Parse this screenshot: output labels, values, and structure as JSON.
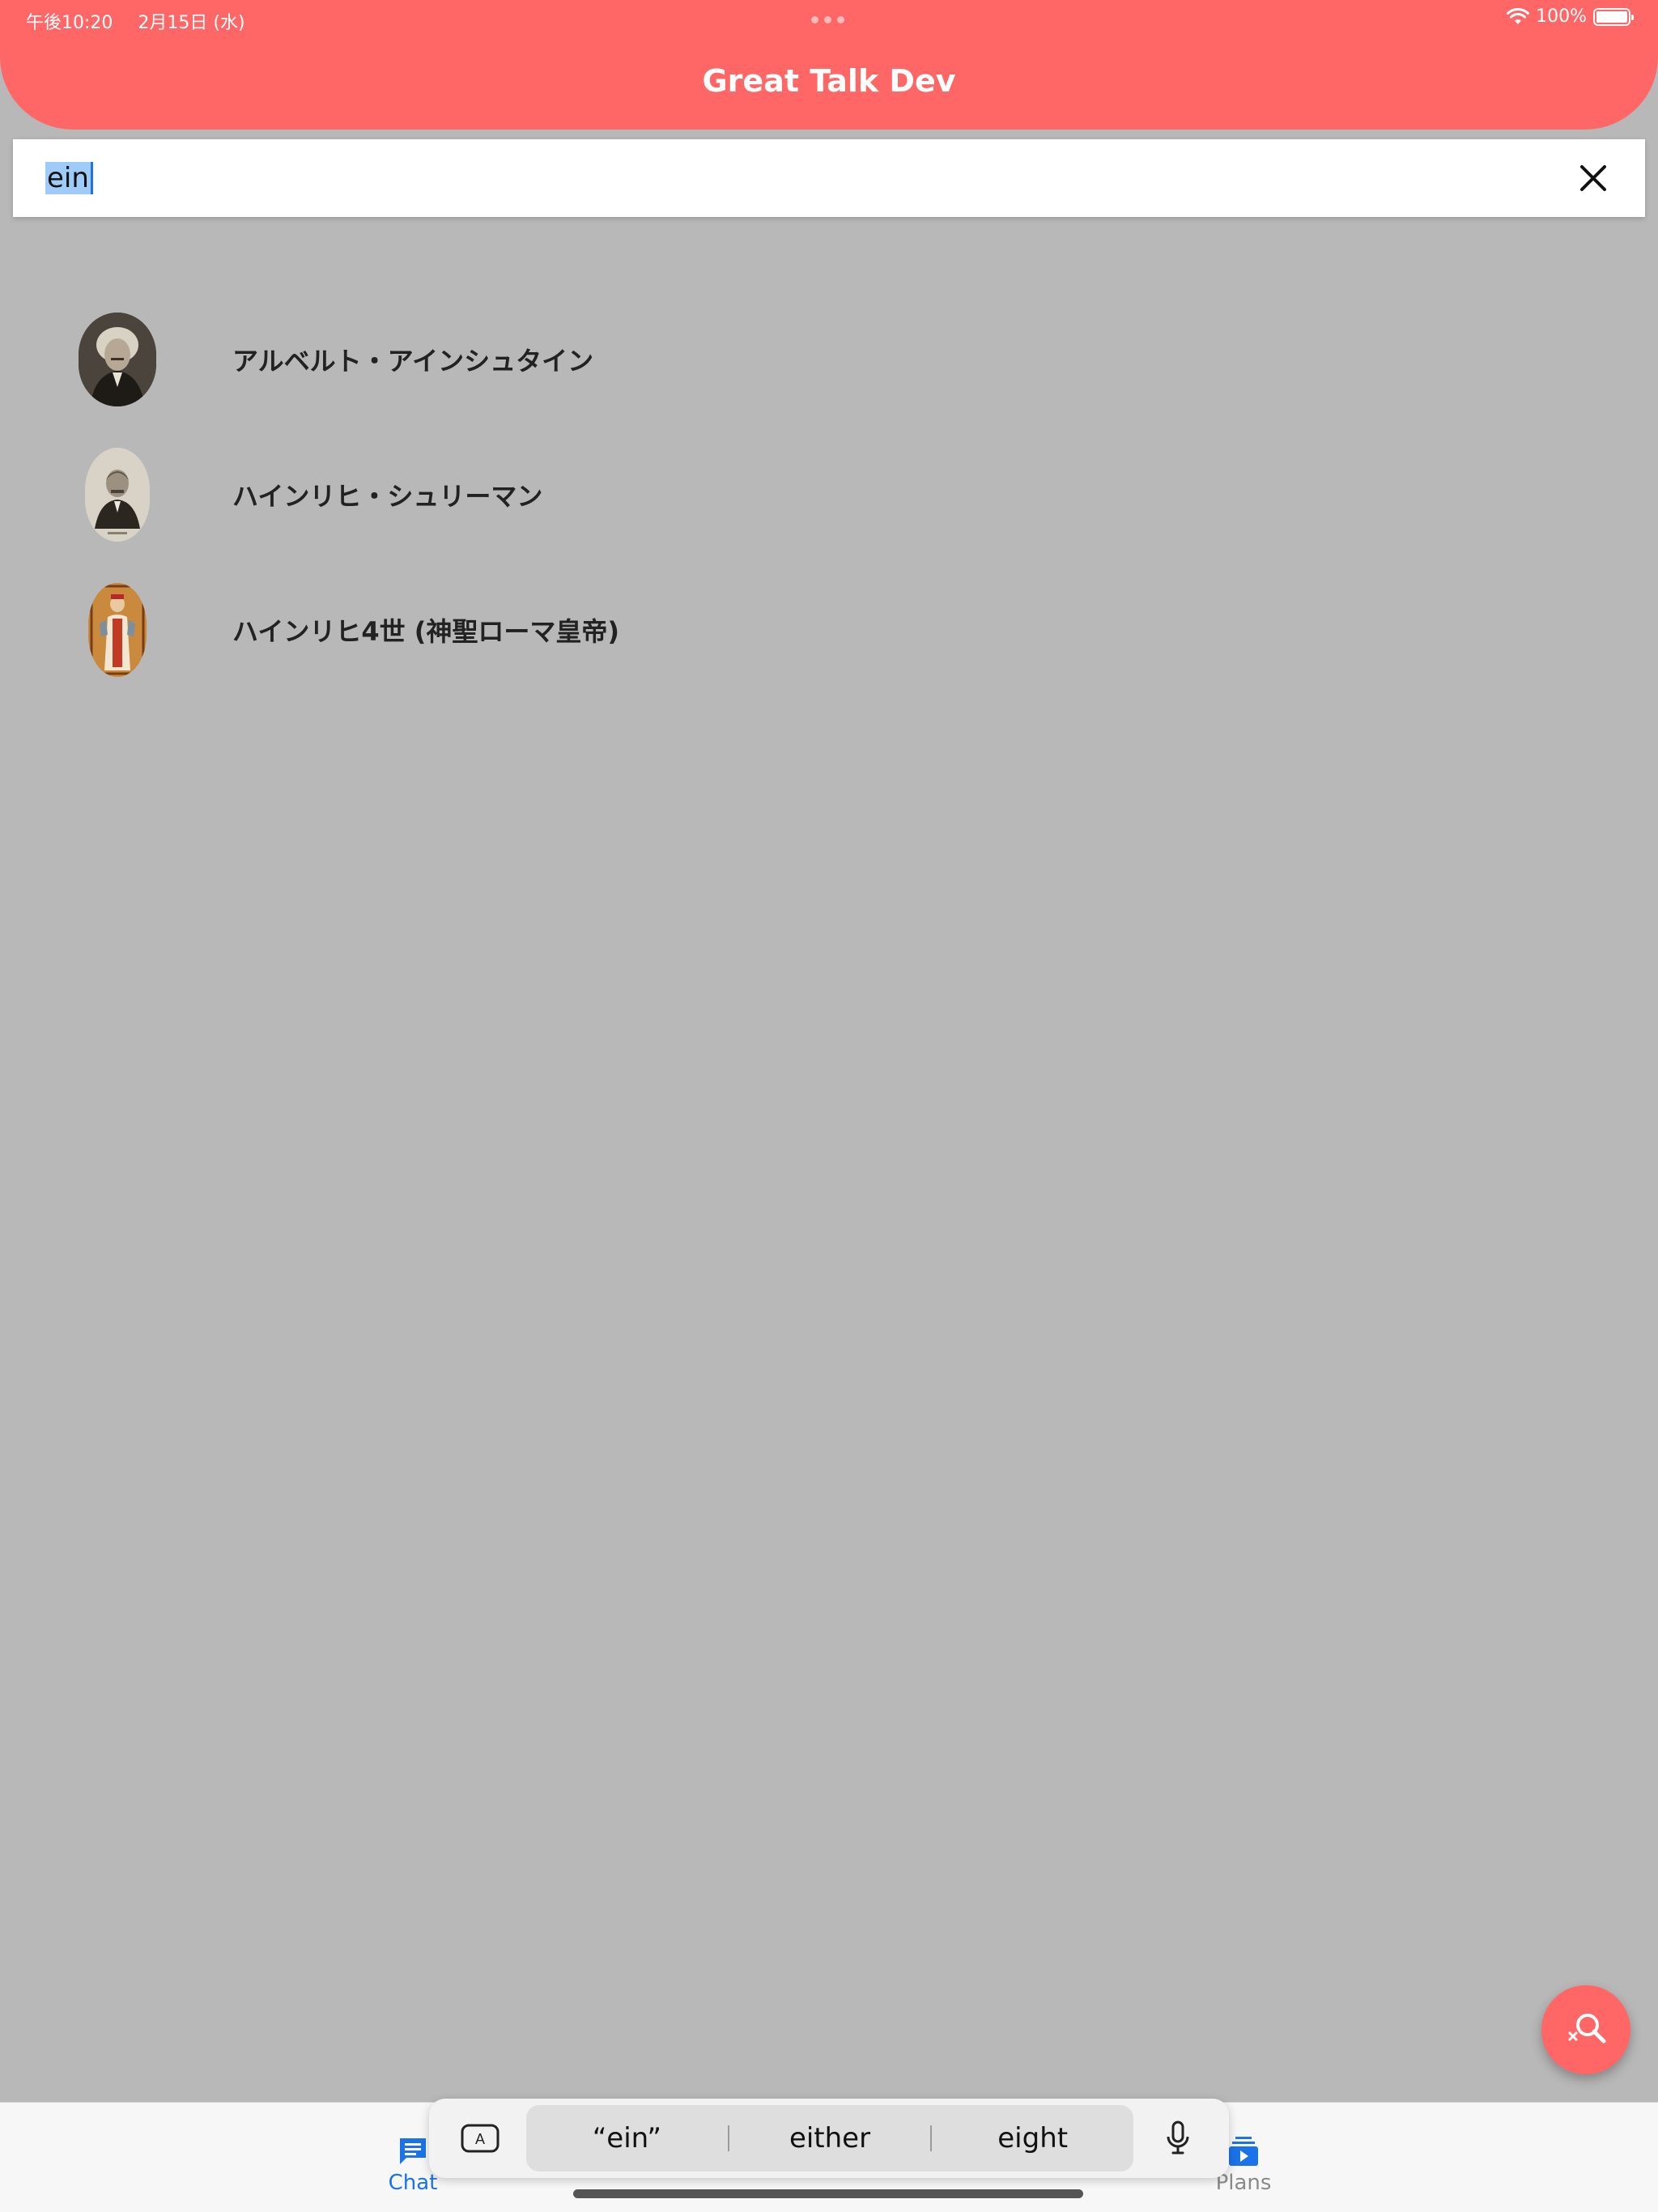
{
  "status_bar": {
    "time": "午後10:20",
    "date": "2月15日 (水)",
    "battery": "100%",
    "battery_level": 1.0
  },
  "header": {
    "title": "Great Talk Dev"
  },
  "search": {
    "query": "ein"
  },
  "results": [
    {
      "name": "アルベルト・アインシュタイン",
      "avatar": "einstein-portrait"
    },
    {
      "name": "ハインリヒ・シュリーマン",
      "avatar": "schliemann-portrait"
    },
    {
      "name": "ハインリヒ4世 (神聖ローマ皇帝)",
      "avatar": "henry-iv-illustration"
    }
  ],
  "bottom_nav": {
    "chat_label": "Chat",
    "plans_label": "Plans"
  },
  "keyboard": {
    "suggestions": [
      "“ein”",
      "either",
      "eight"
    ]
  },
  "colors": {
    "accent": "#ff6666",
    "selection": "#9ecbf7",
    "nav_active": "#1a73e8",
    "background": "#b8b8b8"
  }
}
